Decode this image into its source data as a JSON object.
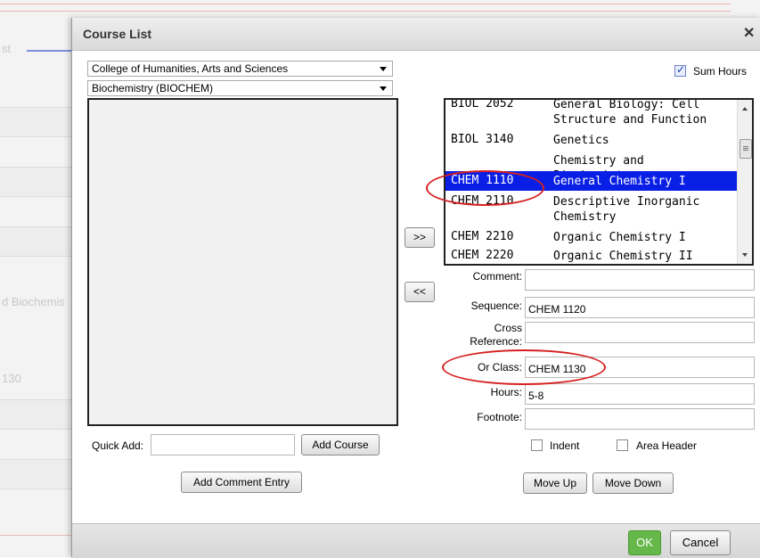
{
  "background": {
    "fragments": [
      "st",
      "d Biochemis",
      "130"
    ]
  },
  "dialog": {
    "title": "Course List",
    "close_symbol": "✕",
    "college_select": "College of Humanities, Arts and Sciences",
    "program_select": "Biochemistry (BIOCHEM)",
    "sum_hours": {
      "label": "Sum Hours",
      "checked": true
    },
    "add_button": ">>",
    "remove_button": "<<",
    "quick_add": {
      "label": "Quick Add:",
      "value": "",
      "button": "Add Course"
    },
    "add_comment_button": "Add Comment Entry",
    "selected_courses": [
      {
        "code": "BIOL 2052",
        "title": "General Biology: Cell Structure and Function"
      },
      {
        "code": "BIOL 3140",
        "title": "Genetics"
      },
      {
        "code": "",
        "title": "Chemistry and Biochemistry:"
      },
      {
        "code": "CHEM 1110",
        "title": "General Chemistry I",
        "selected": true
      },
      {
        "code": "CHEM 2110",
        "title": "Descriptive Inorganic Chemistry"
      },
      {
        "code": "CHEM 2210",
        "title": "Organic Chemistry I"
      },
      {
        "code": "CHEM 2220",
        "title": "Organic Chemistry II"
      }
    ],
    "fields": {
      "comment": {
        "label": "Comment:",
        "value": ""
      },
      "sequence": {
        "label": "Sequence:",
        "value": "CHEM 1120"
      },
      "cross_reference": {
        "label": "Cross Reference:",
        "value": ""
      },
      "or_class": {
        "label": "Or Class:",
        "value": "CHEM 1130"
      },
      "hours": {
        "label": "Hours:",
        "value": "5-8"
      },
      "footnote": {
        "label": "Footnote:",
        "value": ""
      }
    },
    "indent": {
      "label": "Indent",
      "checked": false
    },
    "area_header": {
      "label": "Area Header",
      "checked": false
    },
    "move_up": "Move Up",
    "move_down": "Move Down",
    "ok": "OK",
    "cancel": "Cancel"
  },
  "colors": {
    "selection": "#0a1fe6",
    "ok_green": "#66b84a",
    "annotation_red": "#d62020"
  }
}
